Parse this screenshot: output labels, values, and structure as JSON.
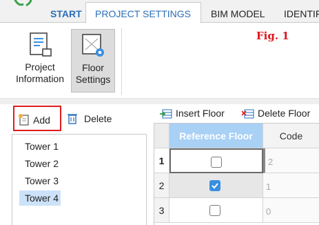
{
  "ribbon_tabs": {
    "start": "START",
    "project_settings": "PROJECT SETTINGS",
    "bim_model": "BIM MODEL",
    "identify": "IDENTIF"
  },
  "ribbon_buttons": {
    "project_information": [
      "Project",
      "Information"
    ],
    "floor_settings": [
      "Floor",
      "Settings"
    ]
  },
  "fig_label": "Fig. 1",
  "tower_panel": {
    "add_label": "Add",
    "delete_label": "Delete",
    "towers": [
      "Tower 1",
      "Tower 2",
      "Tower 3",
      "Tower 4"
    ],
    "selected_tower": "Tower 4"
  },
  "floor_grid": {
    "insert_floor_label": "Insert Floor",
    "delete_floor_label": "Delete Floor",
    "columns": [
      "Reference Floor",
      "Code"
    ],
    "rows": [
      {
        "num": "1",
        "reference": false,
        "code": "2"
      },
      {
        "num": "2",
        "reference": true,
        "code": "1"
      },
      {
        "num": "3",
        "reference": false,
        "code": "0"
      }
    ]
  },
  "colors": {
    "accent": "#2a6fb8",
    "highlight_border": "#e11b1b",
    "header_blue": "#a9d0f5",
    "selection": "#cce2f8",
    "checkbox_on": "#3a8fe0"
  },
  "icons": {
    "logo": "green-app-logo-icon",
    "project_information": "document-icon",
    "floor_settings": "floor-settings-gear-icon",
    "add": "new-document-icon",
    "delete": "trash-icon",
    "insert_floor": "insert-row-icon",
    "delete_floor": "delete-row-icon"
  }
}
